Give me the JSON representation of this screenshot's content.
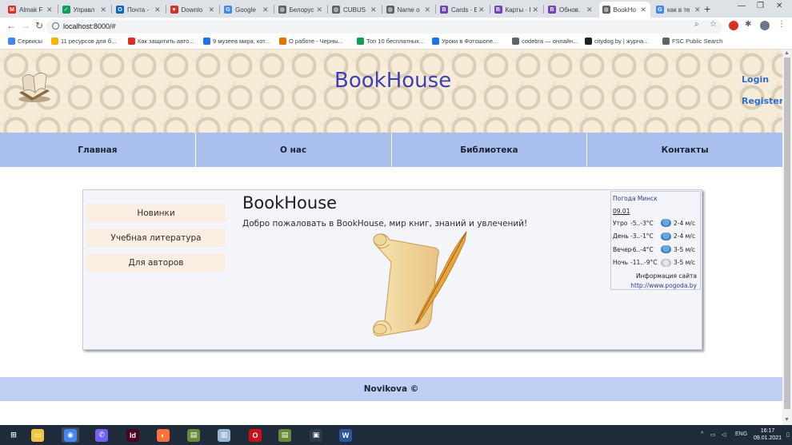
{
  "browser": {
    "tabs": [
      {
        "title": "Almak F",
        "color": "#d93025",
        "glyph": "M"
      },
      {
        "title": "Управл",
        "color": "#0f9d58",
        "glyph": "✓"
      },
      {
        "title": "Почта -",
        "color": "#0a66c2",
        "glyph": "O"
      },
      {
        "title": "Downlo",
        "color": "#d93025",
        "glyph": "♥"
      },
      {
        "title": "Google",
        "color": "#4285f4",
        "glyph": "G"
      },
      {
        "title": "Белорус",
        "color": "#5f6368",
        "glyph": "◍"
      },
      {
        "title": "CUBUS",
        "color": "#5f6368",
        "glyph": "◍"
      },
      {
        "title": "Name o",
        "color": "#5f6368",
        "glyph": "◍"
      },
      {
        "title": "Cards · E",
        "color": "#6f42c1",
        "glyph": "B"
      },
      {
        "title": "Карты · I",
        "color": "#6f42c1",
        "glyph": "B"
      },
      {
        "title": "Обнов.",
        "color": "#6f42c1",
        "glyph": "B"
      },
      {
        "title": "BookHo",
        "color": "#5f6368",
        "glyph": "◍"
      },
      {
        "title": "как в те",
        "color": "#4285f4",
        "glyph": "G"
      }
    ],
    "active_tab_index": 11,
    "url": "localhost:8000/#",
    "bookmarks": [
      {
        "label": "Сервисы",
        "color": "#4285f4"
      },
      {
        "label": "11 ресурсов для б...",
        "color": "#f4b400"
      },
      {
        "label": "Как защитить авто...",
        "color": "#d93025"
      },
      {
        "label": "9 музеев мира, кот...",
        "color": "#1a73e8"
      },
      {
        "label": "О работе - Черны...",
        "color": "#e37400"
      },
      {
        "label": "Топ 10 бесплатных...",
        "color": "#0f9d58"
      },
      {
        "label": "Уроки в Фотошопе...",
        "color": "#1a73e8"
      },
      {
        "label": "codebra — онлайн...",
        "color": "#5f6368"
      },
      {
        "label": "citydog.by | журна...",
        "color": "#202124"
      },
      {
        "label": "FSC Public Search",
        "color": "#5f6368"
      }
    ]
  },
  "site": {
    "title": "BookHouse",
    "login": "Login",
    "register": "Register",
    "nav": [
      "Главная",
      "О нас",
      "Библиотека",
      "Контакты"
    ],
    "sidebar": [
      "Новинки",
      "Учебная литература",
      "Для авторов"
    ],
    "content_title": "BookHouse",
    "content_text": "Добро пожаловать в BookHouse, мир книг, знаний и увлечений!",
    "footer": "Novikova ©"
  },
  "weather": {
    "city": "Погода Минск",
    "date": "09.01",
    "rows": [
      {
        "period": "Утро",
        "temp": "-5..-3°C",
        "wind": "2-4 м/с",
        "icon": "snow"
      },
      {
        "period": "День",
        "temp": "-3..-1°C",
        "wind": "2-4 м/с",
        "icon": "snow"
      },
      {
        "period": "Вечер",
        "temp": "-6..-4°C",
        "wind": "3-5 м/с",
        "icon": "snow"
      },
      {
        "period": "Ночь",
        "temp": "-11..-9°C",
        "wind": "3-5 м/с",
        "icon": "cloud"
      }
    ],
    "info": "Информация сайта",
    "link": "http://www.pogoda.by"
  },
  "taskbar": {
    "lang": "ENG",
    "time": "16:17",
    "date": "09.01.2021",
    "apps": [
      {
        "name": "start-button",
        "color": "#1f2a3a",
        "glyph": "⊞"
      },
      {
        "name": "file-explorer",
        "color": "#f4c542",
        "glyph": "▭"
      },
      {
        "name": "chrome",
        "color": "#4285f4",
        "glyph": "◉"
      },
      {
        "name": "viber",
        "color": "#7360f2",
        "glyph": "✆"
      },
      {
        "name": "indesign",
        "color": "#49021f",
        "glyph": "Id"
      },
      {
        "name": "firefox",
        "color": "#ff7139",
        "glyph": "◐"
      },
      {
        "name": "app",
        "color": "#6a8a3a",
        "glyph": "▤"
      },
      {
        "name": "app",
        "color": "#9bb7d4",
        "glyph": "▥"
      },
      {
        "name": "opera",
        "color": "#cc0f16",
        "glyph": "O"
      },
      {
        "name": "app",
        "color": "#6a8a3a",
        "glyph": "▤"
      },
      {
        "name": "app",
        "color": "#2b3b4d",
        "glyph": "▣"
      },
      {
        "name": "word",
        "color": "#2b579a",
        "glyph": "W"
      }
    ]
  },
  "colors": {
    "title_blue": "#3b3fb8",
    "link_blue": "#2f6bd3",
    "nav_bg": "#a9c0ef",
    "footer_bg": "#bfd0f4"
  }
}
